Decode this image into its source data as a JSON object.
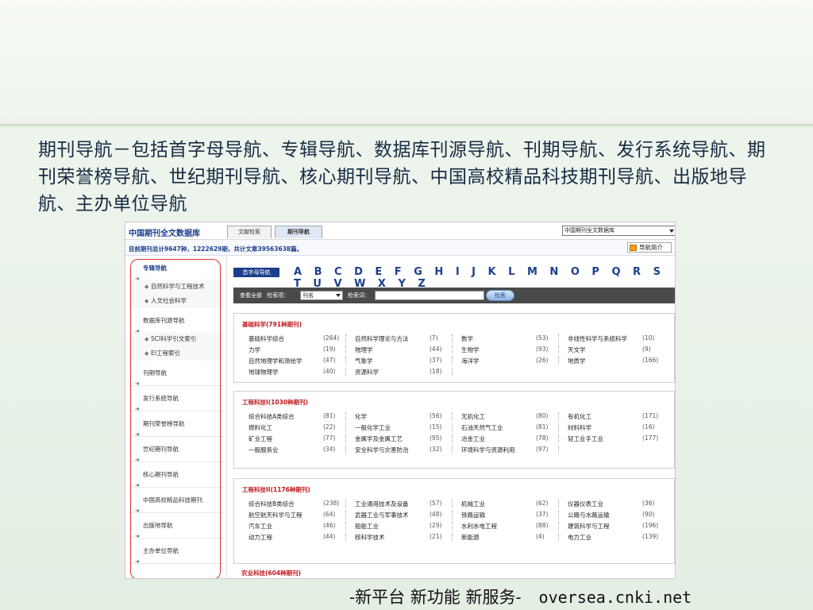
{
  "slide": {
    "heading": "期刊导航－包括首字母导航、专辑导航、数据库刊源导航、刊期导航、发行系统导航、期刊荣誉榜导航、世纪期刊导航、核心期刊导航、中国高校精品科技期刊导航、出版地导航、主办单位导航",
    "footer": "-新平台 新功能 新服务-",
    "footer_url": "oversea.cnki.net"
  },
  "app": {
    "brand": "中国期刊全文数据库",
    "tabs": [
      "文献检索",
      "期刊导航"
    ],
    "db_select": "中国期刊全文数据库",
    "stats": "目前期刊总计9647种，1222629期，共计文章39563638篇。",
    "intro_button": "导航简介"
  },
  "sidebar": {
    "items": [
      {
        "label": "专辑导航",
        "bold": true
      },
      {
        "label": "自然科学与工程技术",
        "sub": true
      },
      {
        "label": "人文社会科学",
        "sub": true
      },
      {
        "label": "数据库刊源导航"
      },
      {
        "label": "SCI科学引文索引",
        "sub": true
      },
      {
        "label": "EI工程索引",
        "sub": true
      },
      {
        "label": "刊期导航"
      },
      {
        "label": "发行系统导航"
      },
      {
        "label": "期刊荣誉榜导航"
      },
      {
        "label": "世纪期刊导航"
      },
      {
        "label": "核心期刊导航"
      },
      {
        "label": "中国高校精品科技期刊"
      },
      {
        "label": "出版地导航"
      },
      {
        "label": "主办单位导航"
      }
    ]
  },
  "main": {
    "alpha_button": "首字母导航",
    "letters": "A B C D E F G H I J K L M N O P Q R S T U V W X Y Z",
    "search": {
      "scope": "查看全部",
      "field_label": "检索项：",
      "field_value": "刊名",
      "word_label": "检索词：",
      "button": "检索"
    },
    "panels": [
      {
        "title": "基础科学(791种期刊)",
        "rows": [
          [
            [
              "基础科学综合",
              "(264)"
            ],
            [
              "自然科学理论与方法",
              "(7)"
            ],
            [
              "数学",
              "(53)"
            ],
            [
              "非线性科学与系统科学",
              "(10)"
            ]
          ],
          [
            [
              "力学",
              "(19)"
            ],
            [
              "物理学",
              "(44)"
            ],
            [
              "生物学",
              "(93)"
            ],
            [
              "天文学",
              "(9)"
            ]
          ],
          [
            [
              "自然地理学和测绘学",
              "(47)"
            ],
            [
              "气象学",
              "(37)"
            ],
            [
              "海洋学",
              "(26)"
            ],
            [
              "地质学",
              "(166)"
            ]
          ],
          [
            [
              "地球物理学",
              "(40)"
            ],
            [
              "资源科学",
              "(18)"
            ],
            [
              "",
              ""
            ],
            [
              "",
              ""
            ]
          ]
        ]
      },
      {
        "title": "工程科技I(1030种期刊)",
        "rows": [
          [
            [
              "综合科技A类综合",
              "(81)"
            ],
            [
              "化学",
              "(56)"
            ],
            [
              "无机化工",
              "(80)"
            ],
            [
              "有机化工",
              "(171)"
            ]
          ],
          [
            [
              "燃料化工",
              "(22)"
            ],
            [
              "一般化学工业",
              "(15)"
            ],
            [
              "石油天然气工业",
              "(81)"
            ],
            [
              "材料科学",
              "(16)"
            ]
          ],
          [
            [
              "矿业工程",
              "(77)"
            ],
            [
              "金属学及金属工艺",
              "(95)"
            ],
            [
              "冶金工业",
              "(78)"
            ],
            [
              "轻工业手工业",
              "(177)"
            ]
          ],
          [
            [
              "一般服务业",
              "(34)"
            ],
            [
              "安全科学与灾害防治",
              "(32)"
            ],
            [
              "环境科学与资源利用",
              "(97)"
            ],
            [
              "",
              ""
            ]
          ]
        ]
      },
      {
        "title": "工程科技II(1176种期刊)",
        "rows": [
          [
            [
              "综合科技B类综合",
              "(238)"
            ],
            [
              "工业通用技术及设备",
              "(57)"
            ],
            [
              "机械工业",
              "(62)"
            ],
            [
              "仪器仪表工业",
              "(36)"
            ]
          ],
          [
            [
              "航空航天科学与工程",
              "(64)"
            ],
            [
              "武器工业与军事技术",
              "(48)"
            ],
            [
              "铁路运输",
              "(37)"
            ],
            [
              "公路与水路运输",
              "(90)"
            ]
          ],
          [
            [
              "汽车工业",
              "(46)"
            ],
            [
              "船舶工业",
              "(29)"
            ],
            [
              "水利水电工程",
              "(88)"
            ],
            [
              "建筑科学与工程",
              "(196)"
            ]
          ],
          [
            [
              "动力工程",
              "(44)"
            ],
            [
              "核科学技术",
              "(21)"
            ],
            [
              "新能源",
              "(4)"
            ],
            [
              "电力工业",
              "(139)"
            ]
          ]
        ]
      }
    ],
    "next_panel_title": "农业科技(604种期刊)"
  }
}
